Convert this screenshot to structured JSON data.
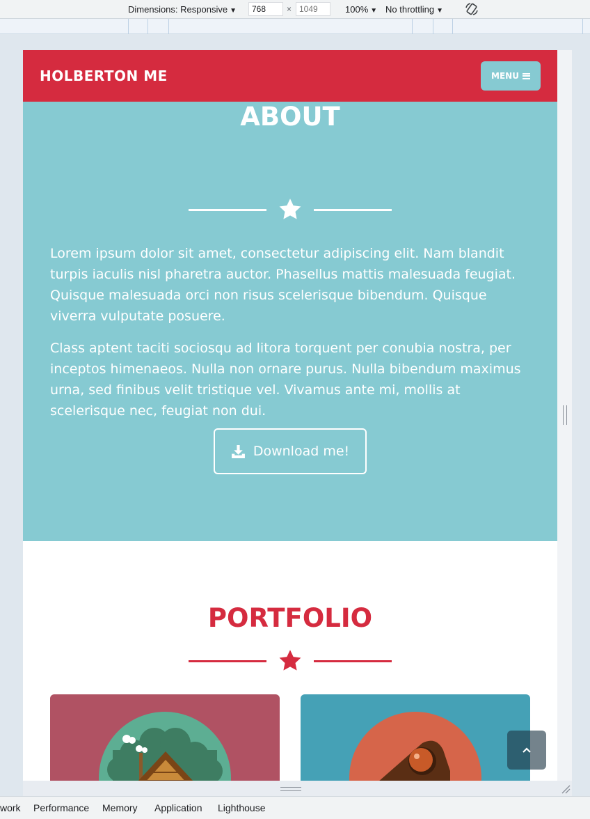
{
  "devtools": {
    "dimensions_label": "Dimensions: Responsive",
    "width_value": "768",
    "height_placeholder": "1049",
    "times": "×",
    "zoom": "100%",
    "throttling": "No throttling",
    "tabs": [
      "work",
      "Performance",
      "Memory",
      "Application",
      "Lighthouse"
    ]
  },
  "site": {
    "brand": "HOLBERTON ME",
    "menu_label": "MENU",
    "about": {
      "title": "ABOUT",
      "paragraphs": [
        "Lorem ipsum dolor sit amet, consectetur adipiscing elit. Nam blandit turpis iaculis nisl pharetra auctor. Phasellus mattis malesuada feugiat. Quisque malesuada orci non risus scelerisque bibendum. Quisque viverra vulputate posuere.",
        "Class aptent taciti sociosqu ad litora torquent per conubia nostra, per inceptos himenaeos. Nulla non ornare purus. Nulla bibendum maximus urna, sed finibus velit tristique vel. Vivamus ante mi, mollis at scelerisque nec, feugiat non dui."
      ],
      "download_label": "Download me!"
    },
    "portfolio": {
      "title": "PORTFOLIO"
    }
  },
  "colors": {
    "brand_red": "#d52b3f",
    "teal": "#86cad2",
    "card_red": "#b05263",
    "card_blue": "#45a1b6"
  },
  "icons": [
    "caret-down-icon",
    "rotate-icon",
    "menu-bars-icon",
    "star-icon",
    "download-icon",
    "chevron-up-icon",
    "resize-grip-icon"
  ]
}
